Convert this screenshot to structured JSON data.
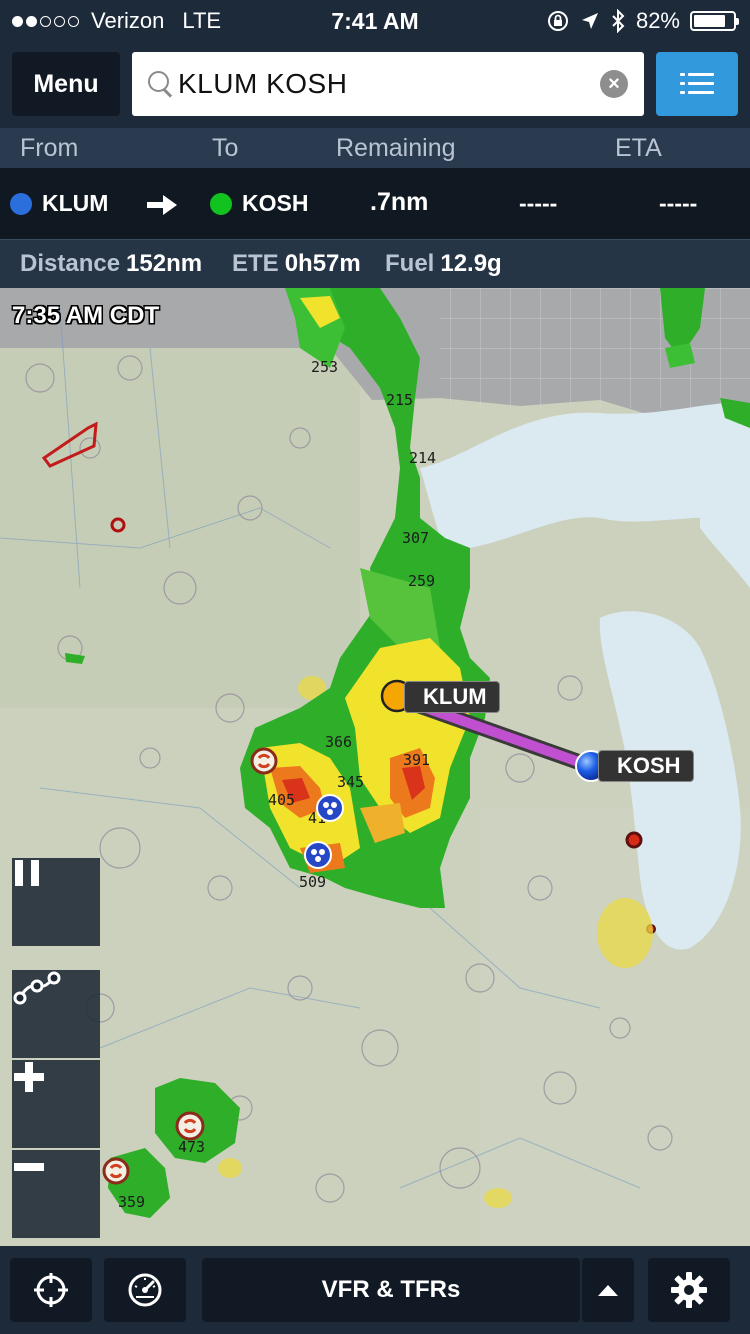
{
  "status_bar": {
    "carrier": "Verizon",
    "network": "LTE",
    "time": "7:41 AM",
    "battery": "82%",
    "battery_level": 0.82,
    "signal_bars_filled": 2,
    "signal_bars_total": 5
  },
  "top_bar": {
    "menu_label": "Menu",
    "search_query": "KLUM KOSH",
    "list_icon": "list-icon"
  },
  "nav_header": {
    "from": "From",
    "to": "To",
    "remaining": "Remaining",
    "eta": "ETA"
  },
  "nav_row": {
    "from_id": "KLUM",
    "to_id": "KOSH",
    "remaining": ".7nm",
    "ete_placeholder": "-----",
    "eta_placeholder": "-----",
    "from_color": "#2b6fdc",
    "to_color": "#12c21e"
  },
  "route_summary": {
    "distance_label": "Distance",
    "distance_value": "152nm",
    "ete_label": "ETE",
    "ete_value": "0h57m",
    "fuel_label": "Fuel",
    "fuel_value": "12.9g"
  },
  "map": {
    "radar_time": "7:35 AM CDT",
    "waypoints": [
      {
        "id": "KLUM",
        "marker_color": "#f5a600"
      },
      {
        "id": "KOSH",
        "marker_color": "#1a55e0"
      }
    ],
    "route_color": "#c050d0",
    "echo_tops": [
      "253",
      "215",
      "214",
      "307",
      "259",
      "366",
      "391",
      "345",
      "405",
      "41",
      "509",
      "473",
      "359"
    ]
  },
  "map_tools": {
    "pause_icon": "pause-icon",
    "route_icon": "route-edit-icon",
    "zoom_in_icon": "zoom-in-icon",
    "zoom_out_icon": "zoom-out-icon"
  },
  "bottom_bar": {
    "layer_label": "VFR & TFRs",
    "locate_icon": "crosshair-icon",
    "instruments_icon": "gauge-icon",
    "expand_icon": "chevron-up-icon",
    "settings_icon": "gear-icon"
  }
}
